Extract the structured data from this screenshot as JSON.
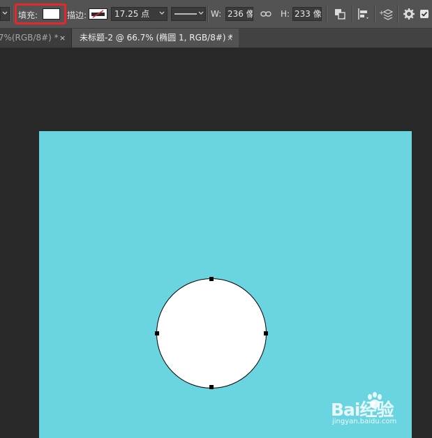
{
  "options_bar": {
    "fill_label": "填充:",
    "stroke_label": "描边:",
    "stroke_width": "17.25 点",
    "width_label": "W:",
    "width_value": "236 像",
    "height_label": "H:",
    "height_value": "233 像",
    "fill_color": "#ffffff",
    "highlight_color": "#e8262b"
  },
  "tabs": [
    {
      "label": ".7%(RGB/8#) *",
      "close": "×",
      "active": false
    },
    {
      "label": "未标题-2 @ 66.7% (椭圆 1, RGB/8#) *",
      "close": "×",
      "active": true
    }
  ],
  "canvas": {
    "background_color": "#6ad5e1",
    "shape": "ellipse",
    "shape_fill": "#ffffff",
    "shape_stroke": "#000000"
  },
  "watermark": {
    "logo_text": "Bai经验",
    "url": "jingyan.baidu.com"
  }
}
